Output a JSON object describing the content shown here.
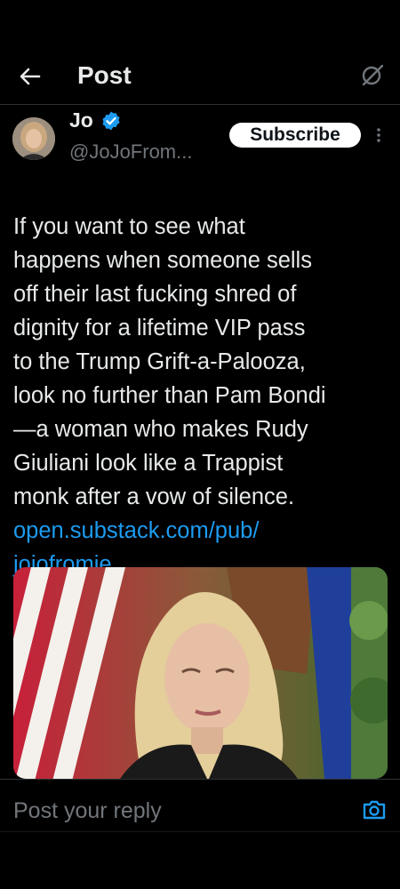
{
  "header": {
    "title": "Post",
    "back_icon": "arrow-left-icon",
    "grok_icon": "grok-icon"
  },
  "author": {
    "name": "Jo",
    "handle": "@JoJoFrom...",
    "verified": true,
    "verified_color": "#1d9bf0"
  },
  "subscribe_label": "Subscribe",
  "tweet": {
    "text": "If you want to see what\nhappens when someone sells\noff their last fucking shred of\ndignity for a lifetime VIP pass\nto the Trump Grift-a-Palooza,\nlook no further than Pam Bondi\n—a woman who makes Rudy\nGiuliani look like a Trappist\nmonk after a vow of silence.",
    "link": "open.substack.com/pub/\njojofromje..."
  },
  "reply": {
    "placeholder": "Post your reply",
    "camera_icon": "camera-icon"
  },
  "colors": {
    "background": "#000000",
    "text": "#e7e9ea",
    "muted": "#71767b",
    "link": "#1d9bf0"
  }
}
